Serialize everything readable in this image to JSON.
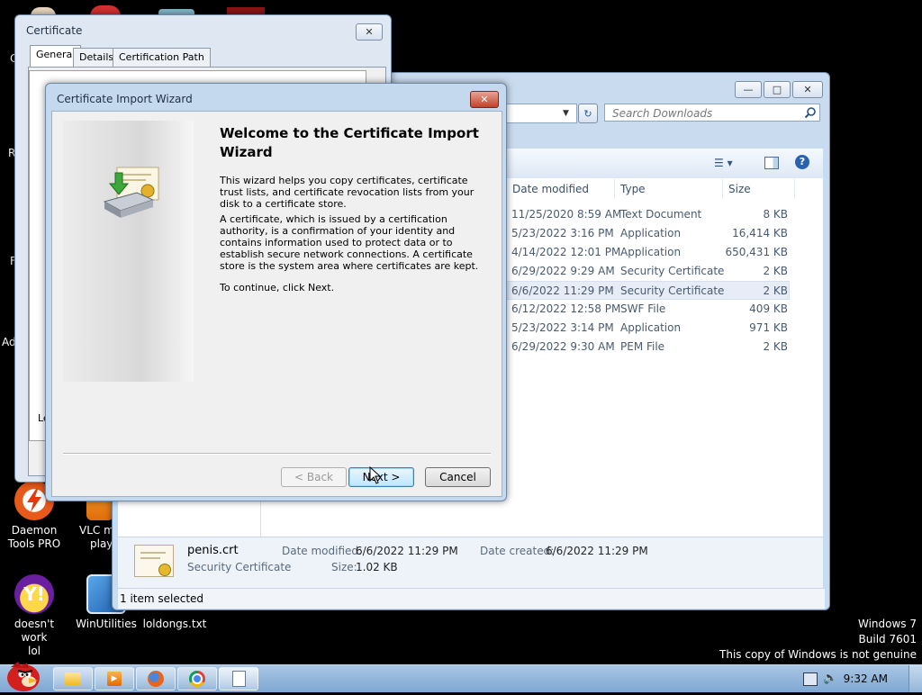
{
  "desktop": {
    "icons": [
      {
        "label_line1": "Daemon",
        "label_line2": "Tools PRO"
      },
      {
        "label_line1": "VLC m",
        "label_line2": "play"
      },
      {
        "label_line1": "doesn't work",
        "label_line2": "lol"
      },
      {
        "label_line1": "WinUtilities",
        "label_line2": ""
      },
      {
        "label_line1": "loldongs.txt",
        "label_line2": ""
      }
    ],
    "left_edge_letters": [
      "C",
      "R",
      "F",
      "Ad",
      "Le"
    ],
    "watermark": {
      "line1": "Windows 7",
      "line2": "Build 7601",
      "line3": "This copy of Windows is not genuine"
    }
  },
  "explorer": {
    "search_placeholder": "Search Downloads",
    "columns": [
      "Date modified",
      "Type",
      "Size"
    ],
    "rows": [
      {
        "date": "11/25/2020 8:59 AM",
        "type": "Text Document",
        "size": "8 KB"
      },
      {
        "date": "5/23/2022 3:16 PM",
        "type": "Application",
        "size": "16,414 KB"
      },
      {
        "date": "4/14/2022 12:01 PM",
        "type": "Application",
        "size": "650,431 KB"
      },
      {
        "date": "6/29/2022 9:29 AM",
        "type": "Security Certificate",
        "size": "2 KB"
      },
      {
        "date": "6/6/2022 11:29 PM",
        "type": "Security Certificate",
        "size": "2 KB"
      },
      {
        "date": "6/12/2022 12:58 PM",
        "type": "SWF File",
        "size": "409 KB"
      },
      {
        "date": "5/23/2022 3:14 PM",
        "type": "Application",
        "size": "971 KB"
      },
      {
        "date": "6/29/2022 9:30 AM",
        "type": "PEM File",
        "size": "2 KB"
      }
    ],
    "details": {
      "filename": "penis.crt",
      "filetype": "Security Certificate",
      "modified_label": "Date modified:",
      "modified_value": "6/6/2022 11:29 PM",
      "created_label": "Date created:",
      "created_value": "6/6/2022 11:29 PM",
      "size_label": "Size:",
      "size_value": "1.02 KB"
    },
    "status": "1 item selected"
  },
  "certificate_window": {
    "title": "Certificate",
    "tabs": [
      "General",
      "Details",
      "Certification Path"
    ]
  },
  "wizard": {
    "title": "Certificate Import Wizard",
    "heading": "Welcome to the Certificate Import Wizard",
    "para1": "This wizard helps you copy certificates, certificate trust lists, and certificate revocation lists from your disk to a certificate store.",
    "para2": "A certificate, which is issued by a certification authority, is a confirmation of your identity and contains information used to protect data or to establish secure network connections. A certificate store is the system area where certificates are kept.",
    "para3": "To continue, click Next.",
    "back_label": "< Back",
    "next_label": "Next >",
    "cancel_label": "Cancel"
  },
  "taskbar": {
    "clock": "9:32 AM"
  },
  "colors": {
    "desktop_bg": "#000000",
    "window_frame": "#c9dbee",
    "selection": "#e6edf6",
    "close_button": "#c3422a"
  }
}
